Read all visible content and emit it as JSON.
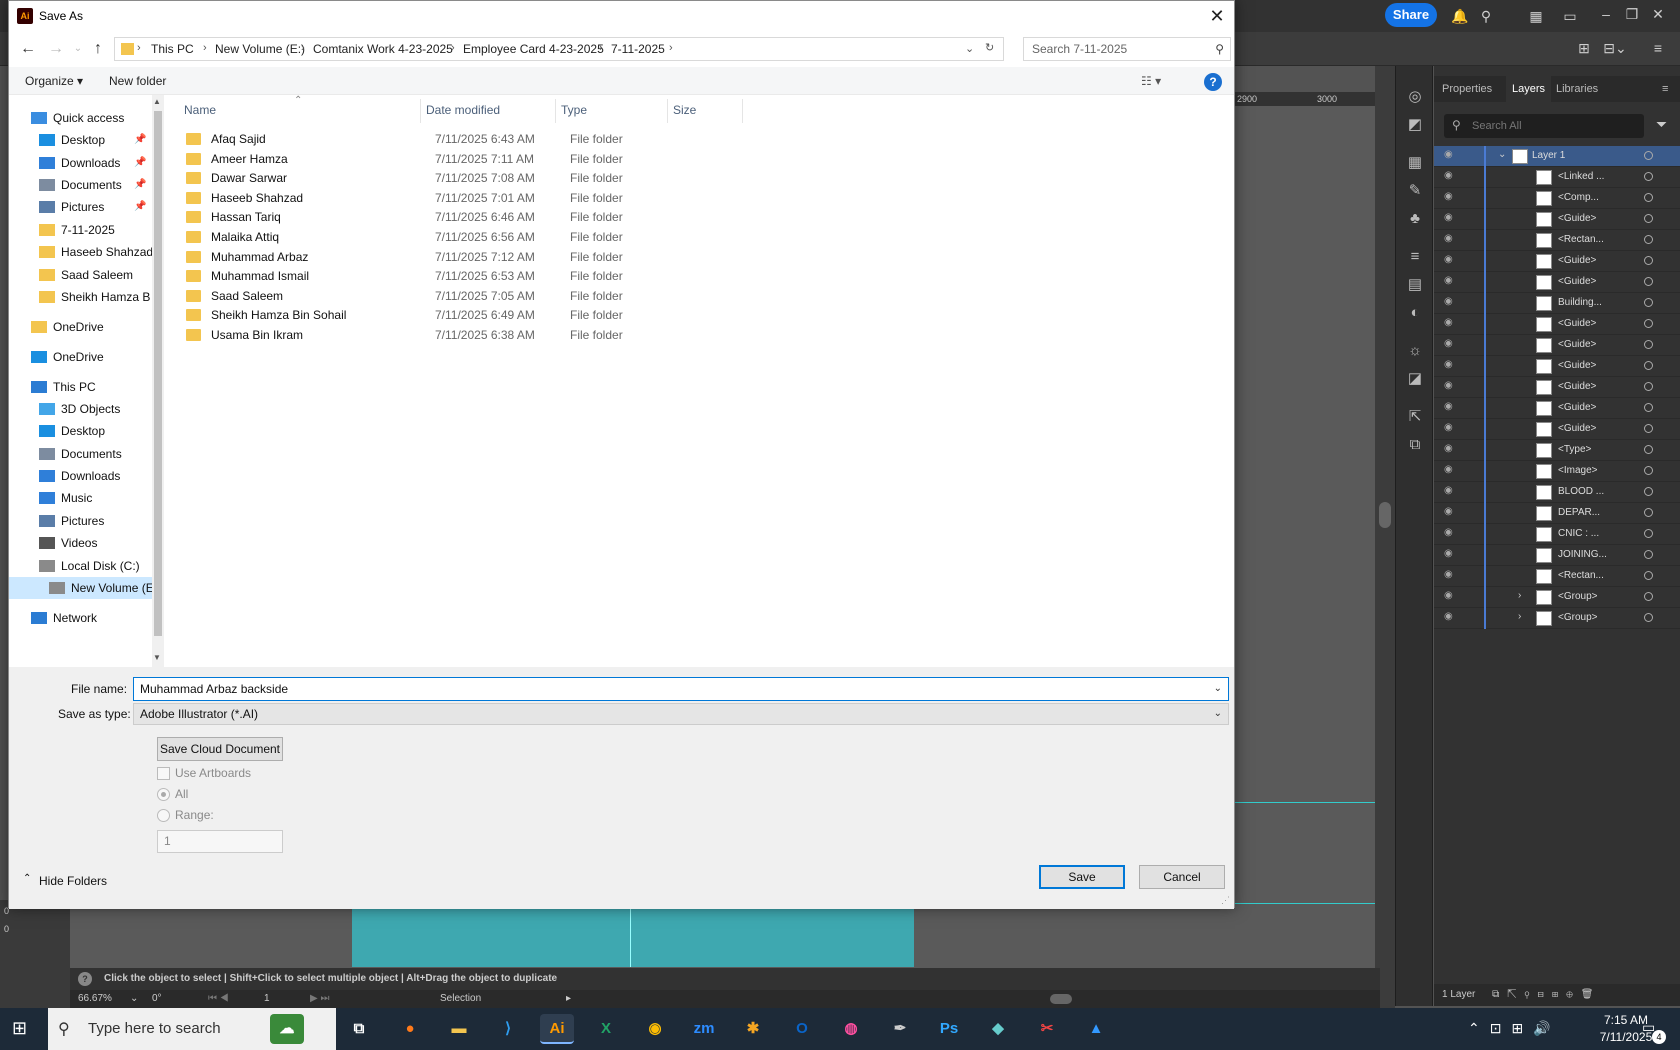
{
  "dialog": {
    "title": "Save As",
    "app_icon": "Ai",
    "breadcrumbs": [
      "This PC",
      "New Volume (E:)",
      "Comtanix Work 4-23-2025",
      "Employee Card 4-23-2025",
      "7-11-2025"
    ],
    "search_placeholder": "Search 7-11-2025",
    "organize": "Organize ▾",
    "new_folder": "New folder",
    "help": "?",
    "nav": [
      {
        "label": "Quick access",
        "icon": "star-icon",
        "pinned": false
      },
      {
        "label": "Desktop",
        "icon": "desktop-icon",
        "pinned": true
      },
      {
        "label": "Downloads",
        "icon": "download-icon",
        "pinned": true
      },
      {
        "label": "Documents",
        "icon": "document-icon",
        "pinned": true
      },
      {
        "label": "Pictures",
        "icon": "pictures-icon",
        "pinned": true
      },
      {
        "label": "7-11-2025",
        "icon": "folder-icon",
        "pinned": false
      },
      {
        "label": "Haseeb Shahzad",
        "icon": "folder-icon",
        "pinned": false
      },
      {
        "label": "Saad Saleem",
        "icon": "folder-icon",
        "pinned": false
      },
      {
        "label": "Sheikh Hamza B",
        "icon": "folder-icon",
        "pinned": false
      },
      {
        "label": "OneDrive",
        "icon": "folder-icon",
        "pinned": false
      },
      {
        "label": "OneDrive",
        "icon": "cloud-icon",
        "pinned": false
      },
      {
        "label": "This PC",
        "icon": "pc-icon",
        "pinned": false
      },
      {
        "label": "3D Objects",
        "icon": "cube-icon",
        "pinned": false
      },
      {
        "label": "Desktop",
        "icon": "desktop-icon",
        "pinned": false
      },
      {
        "label": "Documents",
        "icon": "document-icon",
        "pinned": false
      },
      {
        "label": "Downloads",
        "icon": "download-icon",
        "pinned": false
      },
      {
        "label": "Music",
        "icon": "music-icon",
        "pinned": false
      },
      {
        "label": "Pictures",
        "icon": "pictures-icon",
        "pinned": false
      },
      {
        "label": "Videos",
        "icon": "video-icon",
        "pinned": false
      },
      {
        "label": "Local Disk (C:)",
        "icon": "disk-icon",
        "pinned": false
      },
      {
        "label": "New Volume (E:)",
        "icon": "disk-icon",
        "pinned": false,
        "selected": true
      },
      {
        "label": "Network",
        "icon": "network-icon",
        "pinned": false
      }
    ],
    "columns": {
      "name": "Name",
      "date": "Date modified",
      "type": "Type",
      "size": "Size"
    },
    "files": [
      {
        "name": "Afaq Sajid",
        "date": "7/11/2025 6:43 AM",
        "type": "File folder"
      },
      {
        "name": "Ameer Hamza",
        "date": "7/11/2025 7:11 AM",
        "type": "File folder"
      },
      {
        "name": "Dawar Sarwar",
        "date": "7/11/2025 7:08 AM",
        "type": "File folder"
      },
      {
        "name": "Haseeb Shahzad",
        "date": "7/11/2025 7:01 AM",
        "type": "File folder"
      },
      {
        "name": "Hassan Tariq",
        "date": "7/11/2025 6:46 AM",
        "type": "File folder"
      },
      {
        "name": "Malaika Attiq",
        "date": "7/11/2025 6:56 AM",
        "type": "File folder"
      },
      {
        "name": "Muhammad Arbaz",
        "date": "7/11/2025 7:12 AM",
        "type": "File folder"
      },
      {
        "name": "Muhammad Ismail",
        "date": "7/11/2025 6:53 AM",
        "type": "File folder"
      },
      {
        "name": "Saad Saleem",
        "date": "7/11/2025 7:05 AM",
        "type": "File folder"
      },
      {
        "name": "Sheikh Hamza Bin Sohail",
        "date": "7/11/2025 6:49 AM",
        "type": "File folder"
      },
      {
        "name": "Usama Bin Ikram",
        "date": "7/11/2025 6:38 AM",
        "type": "File folder"
      }
    ],
    "file_name_label": "File name:",
    "file_name_value": "Muhammad Arbaz backside",
    "save_type_label": "Save as type:",
    "save_type_value": "Adobe Illustrator (*.AI)",
    "save_cloud": "Save Cloud Document",
    "use_artboards": "Use Artboards",
    "all": "All",
    "range": "Range:",
    "range_value": "1",
    "hide_folders": "Hide Folders",
    "save": "Save",
    "cancel": "Cancel"
  },
  "illustrator": {
    "share": "Share",
    "ruler_ticks": [
      "2900",
      "3000"
    ],
    "panel_tabs": [
      "Properties",
      "Layers",
      "Libraries"
    ],
    "layer_search": "Search All",
    "layers": [
      {
        "name": "Layer 1",
        "level": 0
      },
      {
        "name": "<Linked ...",
        "level": 1
      },
      {
        "name": "<Comp...",
        "level": 1
      },
      {
        "name": "<Guide>",
        "level": 1
      },
      {
        "name": "<Rectan...",
        "level": 1
      },
      {
        "name": "<Guide>",
        "level": 1
      },
      {
        "name": "<Guide>",
        "level": 1
      },
      {
        "name": "Building...",
        "level": 1
      },
      {
        "name": "<Guide>",
        "level": 1
      },
      {
        "name": "<Guide>",
        "level": 1
      },
      {
        "name": "<Guide>",
        "level": 1
      },
      {
        "name": "<Guide>",
        "level": 1
      },
      {
        "name": "<Guide>",
        "level": 1
      },
      {
        "name": "<Guide>",
        "level": 1
      },
      {
        "name": "<Type>",
        "level": 1
      },
      {
        "name": "<Image>",
        "level": 1
      },
      {
        "name": "BLOOD ...",
        "level": 1
      },
      {
        "name": "DEPAR...",
        "level": 1
      },
      {
        "name": "CNIC : ...",
        "level": 1
      },
      {
        "name": "JOINING...",
        "level": 1
      },
      {
        "name": "<Rectan...",
        "level": 1
      },
      {
        "name": "<Group>",
        "level": 1
      },
      {
        "name": "<Group>",
        "level": 1
      }
    ],
    "layer_count": "1 Layer",
    "status_hint": "Click the object to select  |  Shift+Click to select multiple object  |  Alt+Drag the object to duplicate",
    "zoom": "66.67%",
    "rotation": "0°",
    "artboard_num": "1",
    "tool_name": "Selection",
    "ruler_left": [
      "0",
      "0"
    ]
  },
  "taskbar": {
    "search_placeholder": "Type here to search",
    "time": "7:15 AM",
    "date": "7/11/2025",
    "notif_count": "4"
  }
}
